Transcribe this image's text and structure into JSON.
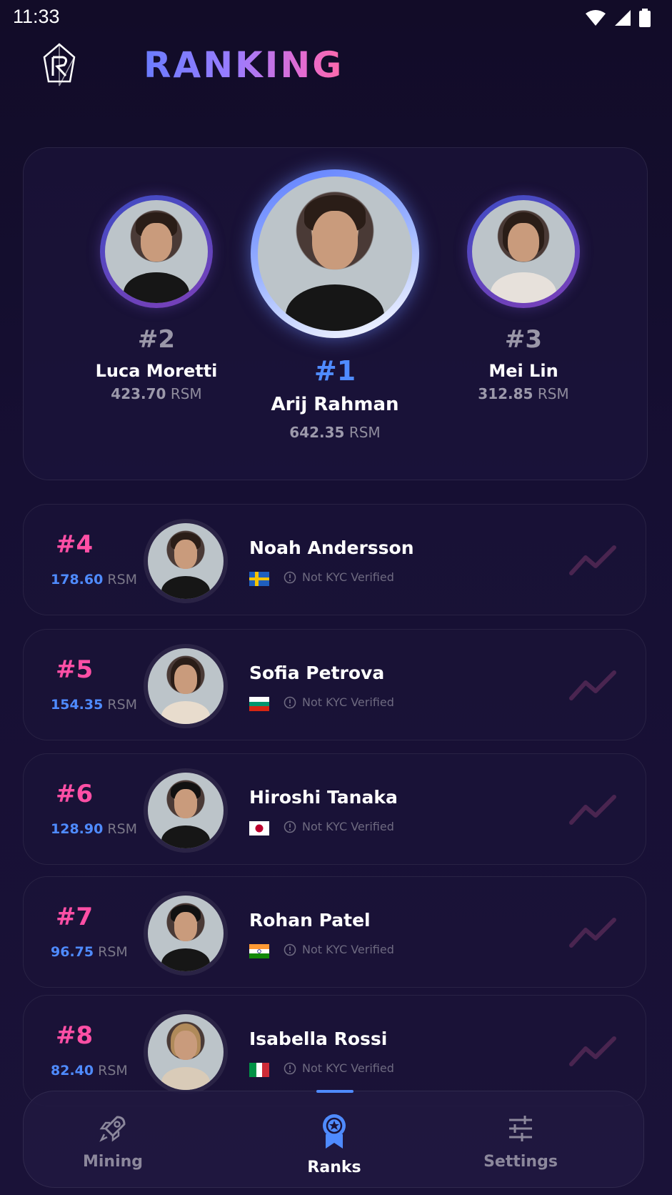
{
  "status_bar": {
    "time": "11:33"
  },
  "header": {
    "title": "RANKING",
    "logo_icon": "diamond-r-logo-icon"
  },
  "podium": [
    {
      "rank": "#2",
      "name": "Luca Moretti",
      "score": "423.70",
      "unit": "RSM"
    },
    {
      "rank": "#1",
      "name": "Arij Rahman",
      "score": "642.35",
      "unit": "RSM"
    },
    {
      "rank": "#3",
      "name": "Mei Lin",
      "score": "312.85",
      "unit": "RSM"
    }
  ],
  "list": [
    {
      "rank": "#4",
      "score": "178.60",
      "unit": "RSM",
      "name": "Noah Andersson",
      "country_flag": "sweden-flag",
      "kyc": "Not KYC Verified"
    },
    {
      "rank": "#5",
      "score": "154.35",
      "unit": "RSM",
      "name": "Sofia Petrova",
      "country_flag": "bulgaria-flag",
      "kyc": "Not KYC Verified"
    },
    {
      "rank": "#6",
      "score": "128.90",
      "unit": "RSM",
      "name": "Hiroshi Tanaka",
      "country_flag": "japan-flag",
      "kyc": "Not KYC Verified"
    },
    {
      "rank": "#7",
      "score": "96.75",
      "unit": "RSM",
      "name": "Rohan Patel",
      "country_flag": "india-flag",
      "kyc": "Not KYC Verified"
    },
    {
      "rank": "#8",
      "score": "82.40",
      "unit": "RSM",
      "name": "Isabella Rossi",
      "country_flag": "italy-flag",
      "kyc": "Not KYC Verified"
    }
  ],
  "nav": {
    "mining": "Mining",
    "ranks": "Ranks",
    "settings": "Settings",
    "active": "ranks"
  },
  "colors": {
    "accent_blue": "#4f8bff",
    "rank_pink": "#ff4fa5",
    "background": "#150e30"
  }
}
